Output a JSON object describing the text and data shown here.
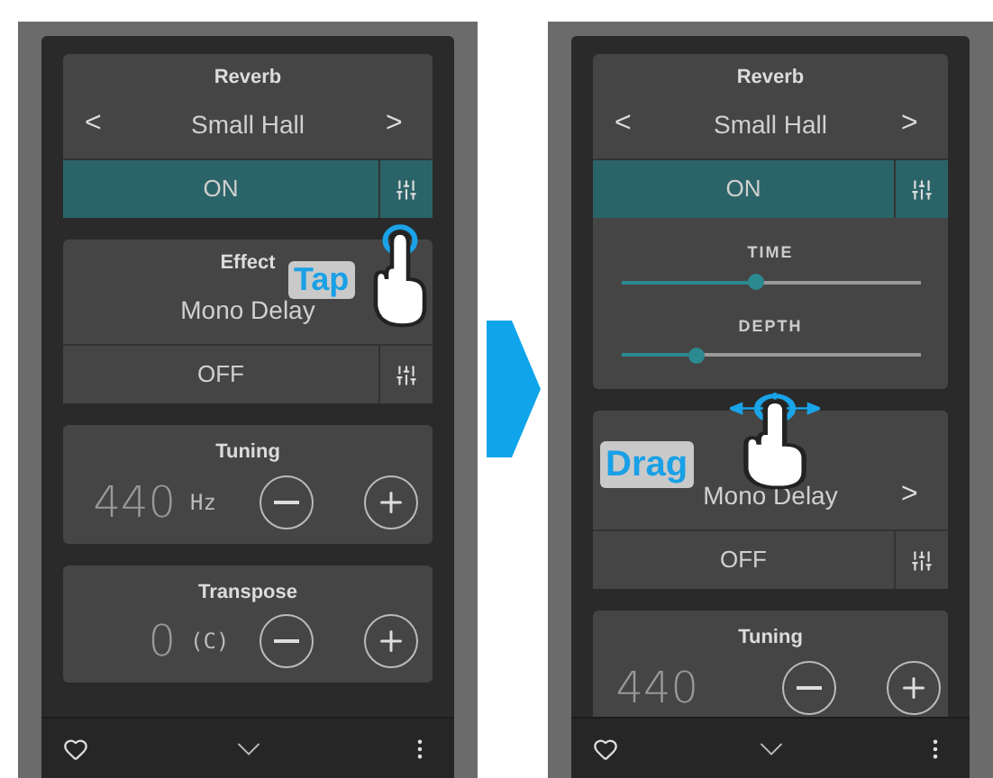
{
  "screens": [
    {
      "cards": [
        {
          "kind": "effect",
          "title": "Reverb",
          "prev": "<",
          "value": "Small Hall",
          "next": ">",
          "toggle": "ON",
          "on": true,
          "expanded": false
        },
        {
          "kind": "effect",
          "title": "Effect",
          "value": "Mono Delay",
          "toggle": "OFF",
          "on": false,
          "expanded": false
        },
        {
          "kind": "stepper",
          "title": "Tuning",
          "value": "440",
          "unit": "Hz"
        },
        {
          "kind": "stepper",
          "title": "Transpose",
          "value": "0",
          "unit": "(C)"
        }
      ],
      "gesture": {
        "kind": "tap",
        "label": "Tap"
      }
    },
    {
      "cards": [
        {
          "kind": "effect",
          "title": "Reverb",
          "prev": "<",
          "value": "Small Hall",
          "next": ">",
          "toggle": "ON",
          "on": true,
          "expanded": true,
          "params": [
            {
              "label": "TIME",
              "level": 0.45
            },
            {
              "label": "DEPTH",
              "level": 0.25
            }
          ]
        },
        {
          "kind": "effect",
          "value": "Mono Delay",
          "next": ">",
          "toggle": "OFF",
          "on": false,
          "expanded": false
        },
        {
          "kind": "stepper",
          "title": "Tuning",
          "value": "440"
        }
      ],
      "gesture": {
        "kind": "drag",
        "label": "Drag"
      }
    }
  ]
}
